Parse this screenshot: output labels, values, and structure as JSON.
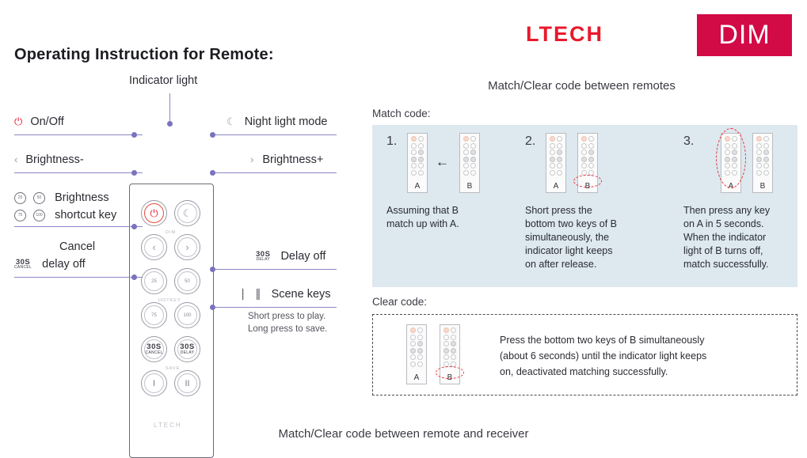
{
  "header": {
    "brand": "LTECH",
    "badge": "DIM"
  },
  "page_title": "Operating Instruction for Remote:",
  "left": {
    "indicator_label": "Indicator light",
    "callouts": {
      "on_off": "On/Off",
      "brightness_down": "Brightness-",
      "brightness_shortcut_line1": "Brightness",
      "brightness_shortcut_line2": "shortcut key",
      "cancel_delay_line1": "Cancel",
      "cancel_delay_line2": "delay off",
      "night_light": "Night light mode",
      "brightness_up": "Brightness+",
      "delay_off": "Delay off",
      "scene_keys": "Scene keys",
      "scene_note_line1": "Short press to play.",
      "scene_note_line2": "Long press to save."
    },
    "icons": {
      "power": "power-icon",
      "moon": "night-light-icon",
      "chevron_left": "‹",
      "chevron_right": "›",
      "scene_1": "I",
      "scene_2": "II"
    },
    "tag_30s": "30S",
    "tag_cancel": "CANCEL",
    "tag_delay": "DELAY",
    "remote": {
      "brand": "LTECH",
      "section_dim": "DIM",
      "section_hotkey": "HOTKEY",
      "section_save": "SAVE",
      "hotkeys": [
        "25",
        "50",
        "75",
        "100"
      ],
      "shortcut_top": [
        "25",
        "50"
      ],
      "shortcut_bottom": [
        "75",
        "100"
      ]
    }
  },
  "right": {
    "heading": "Match/Clear code between remotes",
    "match_label": "Match code:",
    "clear_label": "Clear code:",
    "steps": [
      {
        "num": "1.",
        "text": "Assuming that B\nmatch up with A.",
        "remote_a": "A",
        "remote_b": "B"
      },
      {
        "num": "2.",
        "text": "Short press the\nbottom two keys of B\nsimultaneously, the\nindicator light keeps\non after release.",
        "remote_a": "A",
        "remote_b": "B"
      },
      {
        "num": "3.",
        "text": "Then press any key\non A in 5 seconds.\nWhen the indicator\nlight of B turns off,\nmatch successfully.",
        "remote_a": "A",
        "remote_b": "B"
      }
    ],
    "clear": {
      "remote_a": "A",
      "remote_b": "B",
      "text": "Press the bottom two keys of B simultaneously\n(about 6 seconds) until the indicator light keeps\non, deactivated matching successfully."
    },
    "arrow": "←"
  },
  "bottom_caption": "Match/Clear code between remote and receiver",
  "colors": {
    "brand_red": "#e8192c",
    "badge_bg": "#d20a46",
    "lead_purple": "#8b86c4",
    "panel_bg": "#dde8ef",
    "highlight_red": "#e8323c"
  }
}
